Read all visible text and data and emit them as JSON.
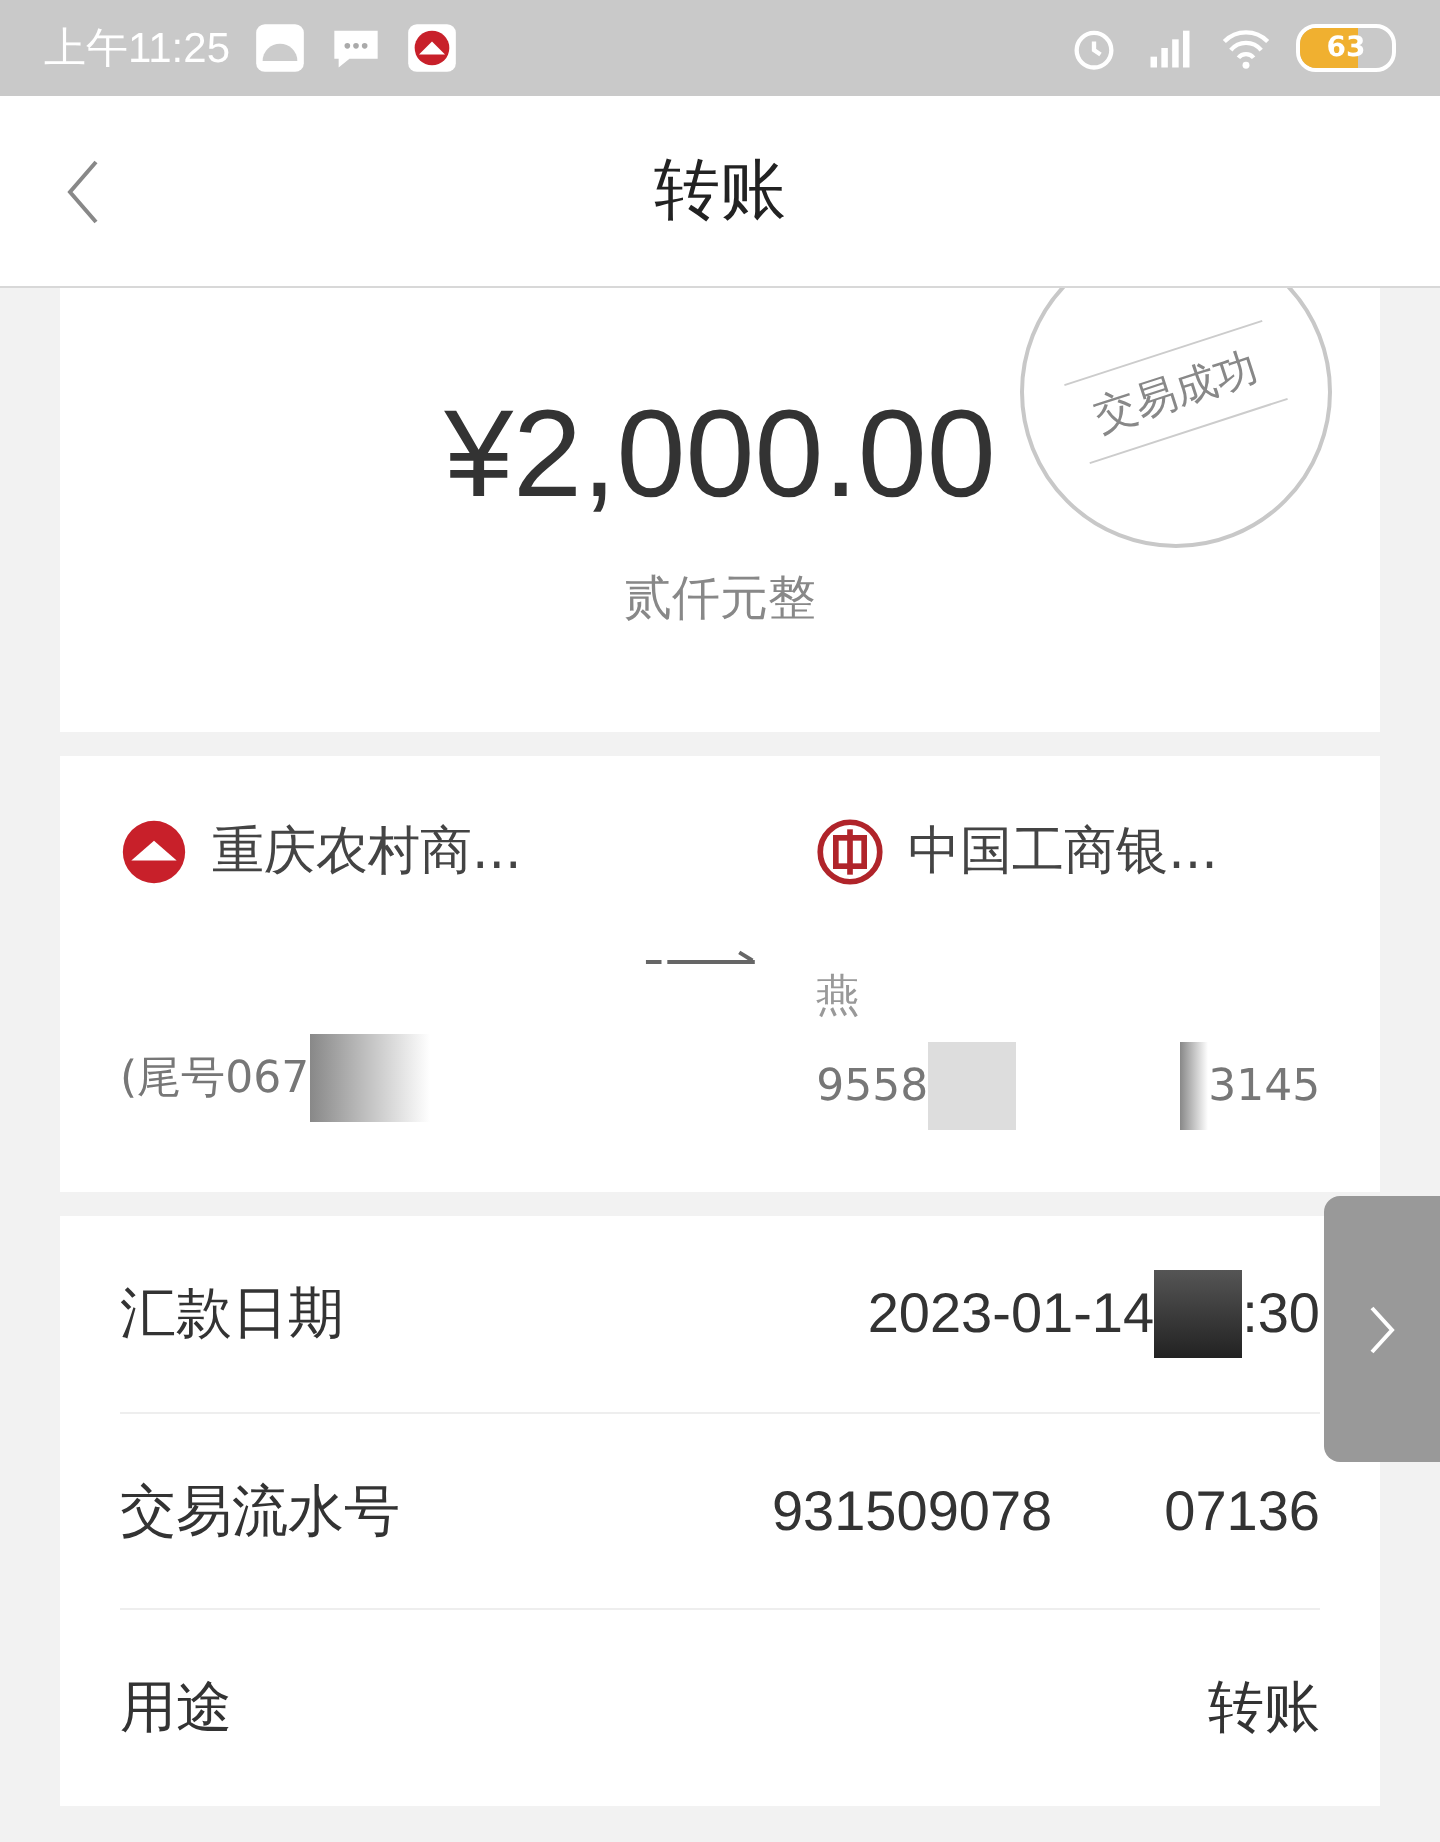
{
  "status_bar": {
    "time": "上午11:25",
    "battery": "63"
  },
  "header": {
    "title": "转账"
  },
  "amount": {
    "value": "¥2,000.00",
    "in_words": "贰仟元整",
    "stamp": "交易成功"
  },
  "transfer": {
    "from": {
      "bank": "重庆农村商...",
      "account": "(尾号067"
    },
    "to": {
      "bank": "中国工商银...",
      "name": "燕",
      "account_start": "9558",
      "account_end": "3145"
    }
  },
  "details": [
    {
      "label": "汇款日期",
      "value_start": "2023-01-14",
      "value_end": ":30"
    },
    {
      "label": "交易流水号",
      "value_start": "931509078",
      "value_end": "07136"
    },
    {
      "label": "用途",
      "value_start": "转账"
    }
  ]
}
